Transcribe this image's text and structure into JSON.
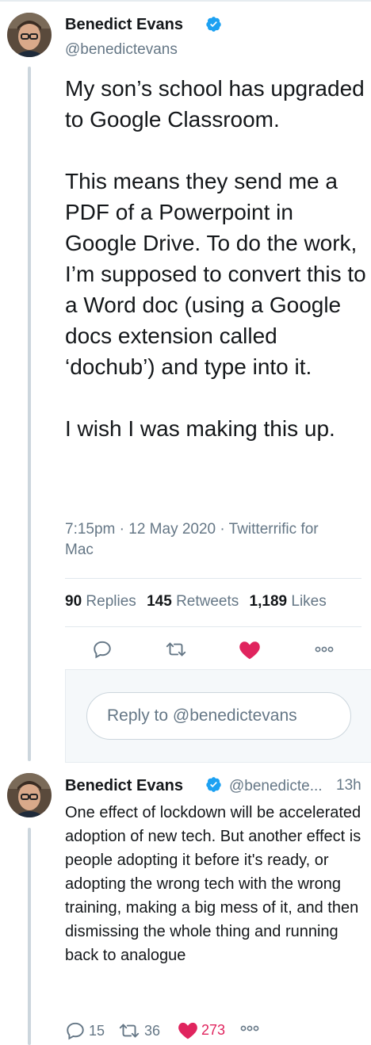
{
  "main_tweet": {
    "author_name": "Benedict Evans",
    "author_handle": "@benedictevans",
    "text": "My son’s school has upgraded to Google Classroom.\n\nThis means they send me a PDF of a Powerpoint in Google Drive. To do the work, I’m supposed to convert this to a Word doc (using a Google docs extension called ‘dochub’) and type into it.\n\nI wish I was making this up.",
    "meta": "7:15pm · 12 May 2020 · Twitterrific for Mac",
    "stats": {
      "replies_count": "90",
      "replies_label": "Replies",
      "retweets_count": "145",
      "retweets_label": "Retweets",
      "likes_count": "1,189",
      "likes_label": "Likes"
    }
  },
  "reply_composer": {
    "placeholder": "Reply to @benedictevans"
  },
  "reply_tweet": {
    "author_name": "Benedict Evans",
    "author_handle": "@benedicte...",
    "time": "13h",
    "text": "One effect of lockdown will be accelerated adoption of new tech. But another effect is people adopting it before it's ready, or adopting the wrong tech with the wrong training, making a big mess of it, and then dismissing the whole thing and running back to analogue",
    "replies_count": "15",
    "retweets_count": "36",
    "likes_count": "273"
  },
  "icons": [
    "reply-icon",
    "retweet-icon",
    "like-icon",
    "more-icon",
    "verified-icon"
  ],
  "colors": {
    "like": "#e0245e",
    "verified": "#1da1f2",
    "secondary_text": "#657786"
  }
}
